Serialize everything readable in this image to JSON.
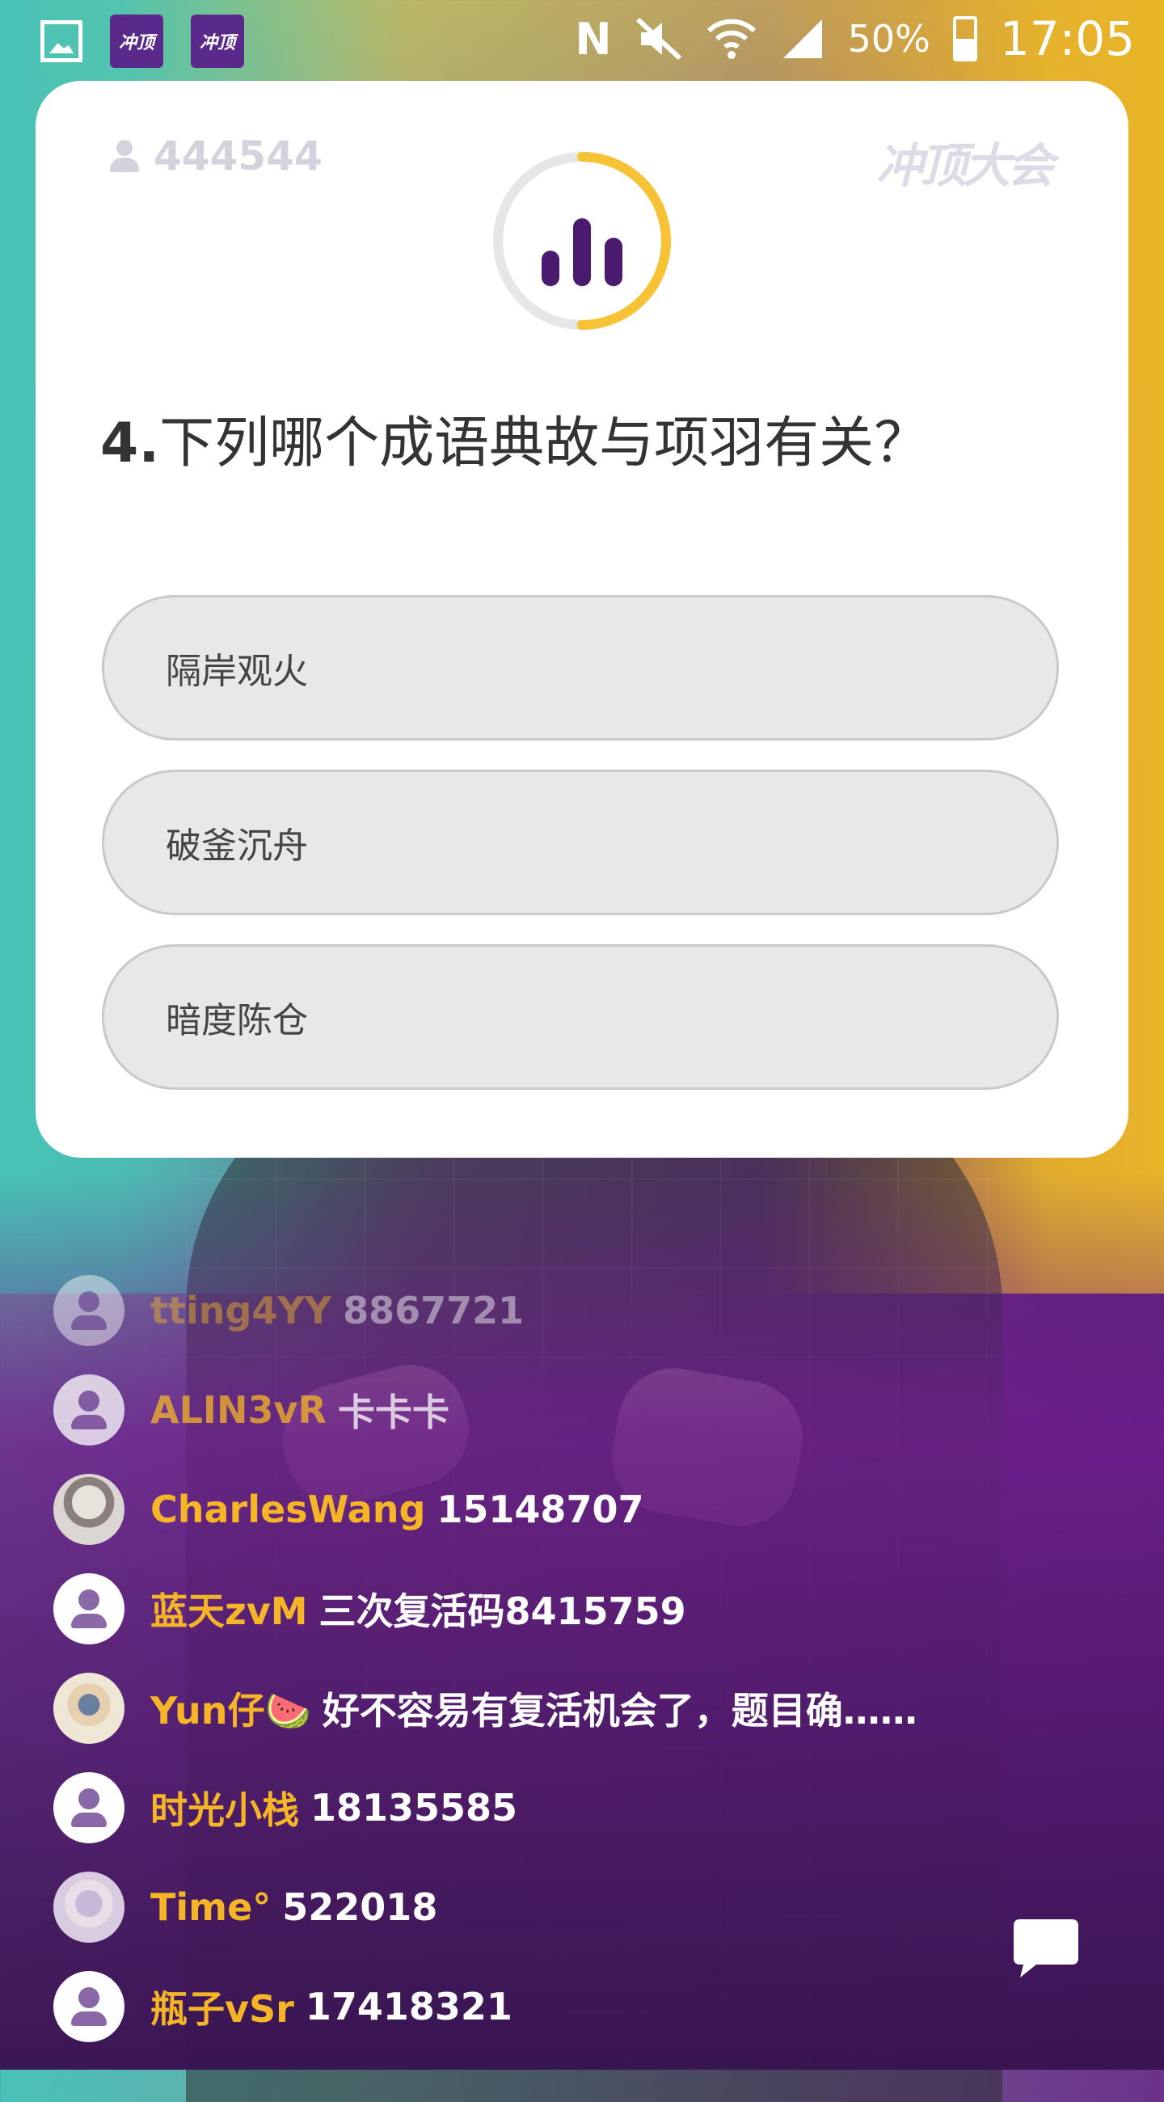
{
  "status_bar": {
    "app_icon_label": "冲顶",
    "battery_percent": "50%",
    "time": "17:05",
    "icons": [
      "gallery-icon",
      "app-icon",
      "nfc-icon",
      "mute-icon",
      "wifi-icon",
      "signal-icon",
      "battery-charging-icon"
    ]
  },
  "card": {
    "viewer_count": "444544",
    "brand": "冲顶大会",
    "timer_progress": 0.5,
    "question_number": "4.",
    "question_text": "下列哪个成语典故与项羽有关？",
    "options": [
      "隔岸观火",
      "破釜沉舟",
      "暗度陈仓"
    ]
  },
  "chat": [
    {
      "name": "tting4YY",
      "text": "8867721",
      "avatar": "default"
    },
    {
      "name": "ALIN3vR",
      "text": "卡卡卡",
      "avatar": "default"
    },
    {
      "name": "CharlesWang",
      "text": "15148707",
      "avatar": "photo1"
    },
    {
      "name": "蓝天zvM",
      "text": "三次复活码8415759",
      "avatar": "default"
    },
    {
      "name": "Yun仔🍉",
      "text": "好不容易有复活机会了，题目确……",
      "avatar": "photo2"
    },
    {
      "name": "时光小栈",
      "text": "18135585",
      "avatar": "default"
    },
    {
      "name": "Time°",
      "text": "522018",
      "avatar": "photo3"
    },
    {
      "name": "瓶子vSr",
      "text": "17418321",
      "avatar": "default"
    }
  ],
  "colors": {
    "name_color": "#f6b526",
    "timer_arc": "#f8c236",
    "timer_track": "#e6e6e6",
    "bars": "#4a1a6e"
  }
}
